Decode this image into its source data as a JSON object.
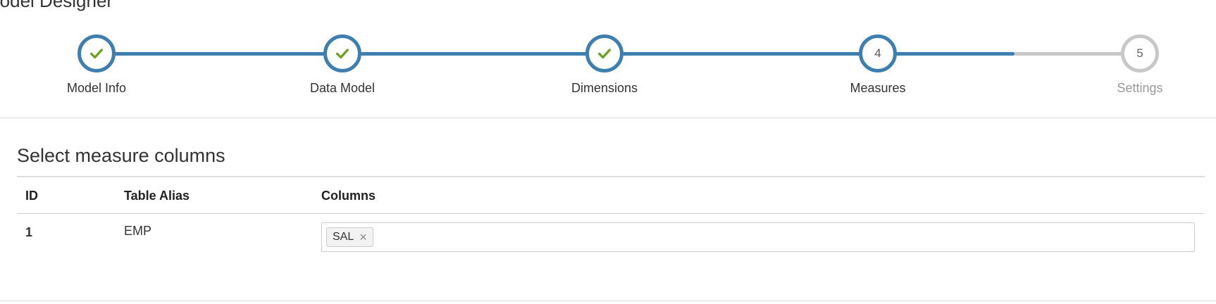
{
  "page": {
    "title": "Model Designer"
  },
  "wizard": {
    "steps": [
      {
        "label": "Model Info",
        "number": "1",
        "status": "done",
        "icon": "checkmark-icon"
      },
      {
        "label": "Data Model",
        "number": "2",
        "status": "done",
        "icon": "checkmark-icon"
      },
      {
        "label": "Dimensions",
        "number": "3",
        "status": "done",
        "icon": "checkmark-icon"
      },
      {
        "label": "Measures",
        "number": "4",
        "status": "current"
      },
      {
        "label": "Settings",
        "number": "5",
        "status": "pending"
      }
    ],
    "colors": {
      "active": "#3f7fb0",
      "inactive": "#c8c8c8",
      "check": "#6aa121"
    }
  },
  "measures": {
    "title": "Select measure columns",
    "table": {
      "headers": [
        "ID",
        "Table Alias",
        "Columns"
      ],
      "rows": [
        {
          "id": "1",
          "alias": "EMP",
          "columns": [
            "SAL"
          ]
        }
      ]
    },
    "tag_remove_glyph": "×"
  }
}
